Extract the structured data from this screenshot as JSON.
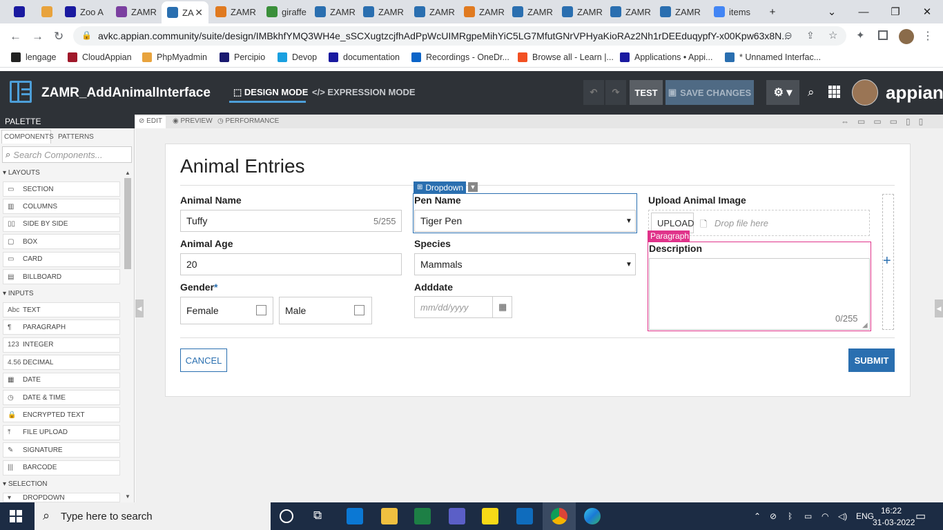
{
  "browser": {
    "tabs": [
      {
        "label": "",
        "icon": "appian-icon",
        "color": "#1a1aa0"
      },
      {
        "label": "",
        "icon": "pma-icon",
        "color": "#e8a33d"
      },
      {
        "label": "Zoo A",
        "icon": "appian-icon",
        "color": "#1a1aa0"
      },
      {
        "label": "ZAMR",
        "icon": "component-icon",
        "color": "#7b3fa0"
      },
      {
        "label": "ZA",
        "icon": "interface-icon",
        "color": "#2a6fb0",
        "active": true
      },
      {
        "label": "ZAMR",
        "icon": "record-icon",
        "color": "#e07a20"
      },
      {
        "label": "giraffe",
        "icon": "leaf-icon",
        "color": "#3a8f3a"
      },
      {
        "label": "ZAMR",
        "icon": "interface-icon",
        "color": "#2a6fb0"
      },
      {
        "label": "ZAMR",
        "icon": "interface-icon",
        "color": "#2a6fb0"
      },
      {
        "label": "ZAMR",
        "icon": "interface-icon",
        "color": "#2a6fb0"
      },
      {
        "label": "ZAMR",
        "icon": "record-icon",
        "color": "#e07a20"
      },
      {
        "label": "ZAMR",
        "icon": "interface-icon",
        "color": "#2a6fb0"
      },
      {
        "label": "ZAMR",
        "icon": "interface-icon",
        "color": "#2a6fb0"
      },
      {
        "label": "ZAMR",
        "icon": "interface-icon",
        "color": "#2a6fb0"
      },
      {
        "label": "ZAMR",
        "icon": "interface-icon",
        "color": "#2a6fb0"
      },
      {
        "label": "items",
        "icon": "google-icon",
        "color": "#4285f4"
      }
    ],
    "url": "avkc.appian.community/suite/design/IMBkhfYMQ3WH4e_sSCXugtzcjfhAdPpWcUIMRgpeMihYiC5LG7MfutGNrVPHyaKioRAz2Nh1rDEEduqypfY-x00Kpw63x8N...",
    "bookmarks": [
      "lengage",
      "CloudAppian",
      "PhpMyadmin",
      "Percipio",
      "Devop",
      "documentation",
      "Recordings - OneDr...",
      "Browse all - Learn |...",
      "Applications • Appi...",
      "* Unnamed Interfac..."
    ]
  },
  "app": {
    "title": "ZAMR_AddAnimalInterface",
    "design_mode": "DESIGN MODE",
    "expression_mode": "EXPRESSION MODE",
    "test": "TEST",
    "save": "SAVE CHANGES",
    "brand": "appian"
  },
  "palette": {
    "title": "PALETTE",
    "tab_components": "COMPONENTS",
    "tab_patterns": "PATTERNS",
    "search_placeholder": "Search Components...",
    "sections": {
      "layouts": "LAYOUTS",
      "inputs": "INPUTS",
      "selection": "SELECTION"
    },
    "layouts": [
      "SECTION",
      "COLUMNS",
      "SIDE BY SIDE",
      "BOX",
      "CARD",
      "BILLBOARD"
    ],
    "inputs": [
      "TEXT",
      "PARAGRAPH",
      "INTEGER",
      "DECIMAL",
      "DATE",
      "DATE & TIME",
      "ENCRYPTED TEXT",
      "FILE UPLOAD",
      "SIGNATURE",
      "BARCODE"
    ],
    "input_prefixes": [
      "Abc",
      "¶",
      "123",
      "4.56",
      "▦",
      "◷",
      "🔒",
      "⤒",
      "✎",
      "|||"
    ],
    "selection": [
      "DROPDOWN"
    ]
  },
  "canvas_tabs": {
    "edit": "EDIT",
    "preview": "PREVIEW",
    "performance": "PERFORMANCE"
  },
  "form": {
    "title": "Animal Entries",
    "animal_name_label": "Animal Name",
    "animal_name_value": "Tuffy",
    "animal_name_count": "5/255",
    "pen_name_label": "Pen Name",
    "pen_name_value": "Tiger Pen",
    "dropdown_tag": "Dropdown",
    "upload_label": "Upload Animal Image",
    "upload_button": "UPLOAD",
    "drop_text": "Drop file here",
    "paragraph_tag": "Paragraph",
    "description_label": "Description",
    "description_count": "0/255",
    "animal_age_label": "Animal Age",
    "animal_age_value": "20",
    "species_label": "Species",
    "species_value": "Mammals",
    "gender_label": "Gender",
    "gender_required": "*",
    "gender_options": [
      "Female",
      "Male"
    ],
    "adddate_label": "Adddate",
    "adddate_placeholder": "mm/dd/yyyy",
    "cancel": "CANCEL",
    "submit": "SUBMIT"
  },
  "taskbar": {
    "search_placeholder": "Type here to search",
    "lang": "ENG",
    "time": "16:22",
    "date": "31-03-2022"
  }
}
